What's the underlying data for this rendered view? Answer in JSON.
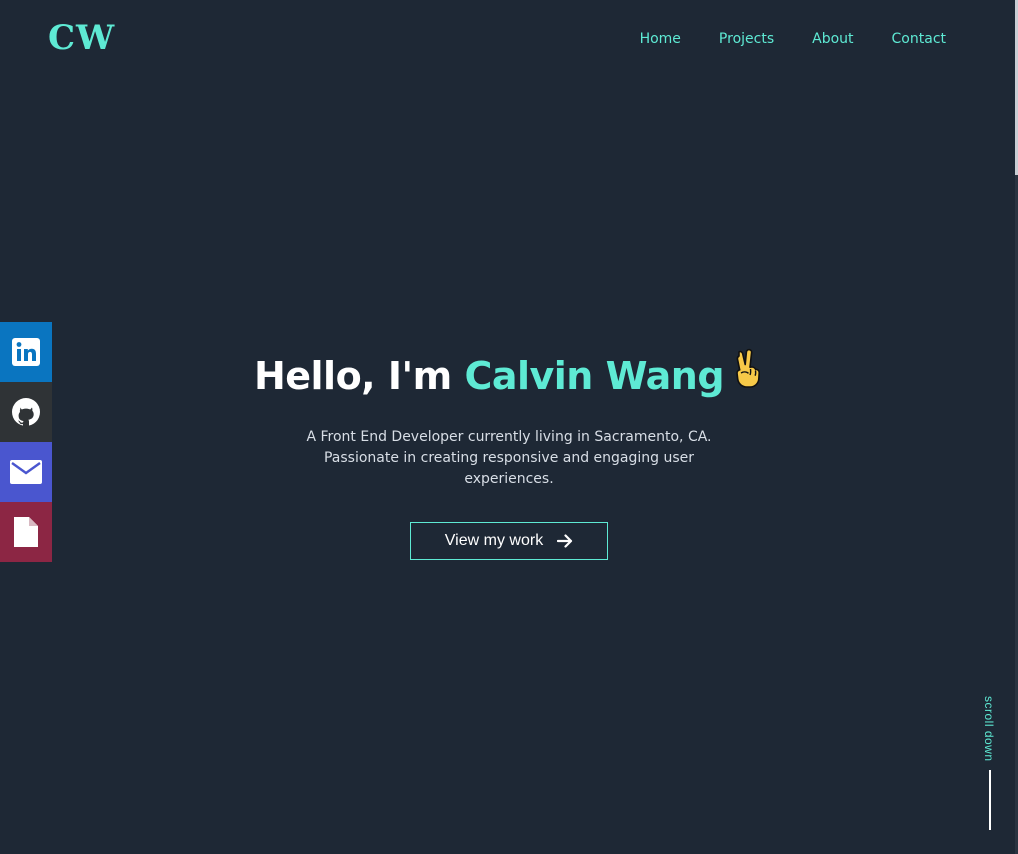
{
  "header": {
    "logo": "CW",
    "nav": [
      {
        "label": "Home"
      },
      {
        "label": "Projects"
      },
      {
        "label": "About"
      },
      {
        "label": "Contact"
      }
    ]
  },
  "social": [
    {
      "name": "linkedin-icon",
      "color": "#0a75c0"
    },
    {
      "name": "github-icon",
      "color": "#2f3336"
    },
    {
      "name": "email-icon",
      "color": "#4a56cf"
    },
    {
      "name": "resume-icon",
      "color": "#8c2644"
    }
  ],
  "hero": {
    "greeting": "Hello, I'm ",
    "name": "Calvin Wang",
    "emoji": "✌",
    "intro": "A Front End Developer currently living in Sacramento, CA. Passionate in creating responsive and engaging user experiences.",
    "cta_label": "View my work",
    "cta_icon": "arrow-right-icon"
  },
  "scroll_hint": "scroll down",
  "colors": {
    "background": "#1e2835",
    "accent": "#5eead4",
    "text": "#ffffff"
  }
}
